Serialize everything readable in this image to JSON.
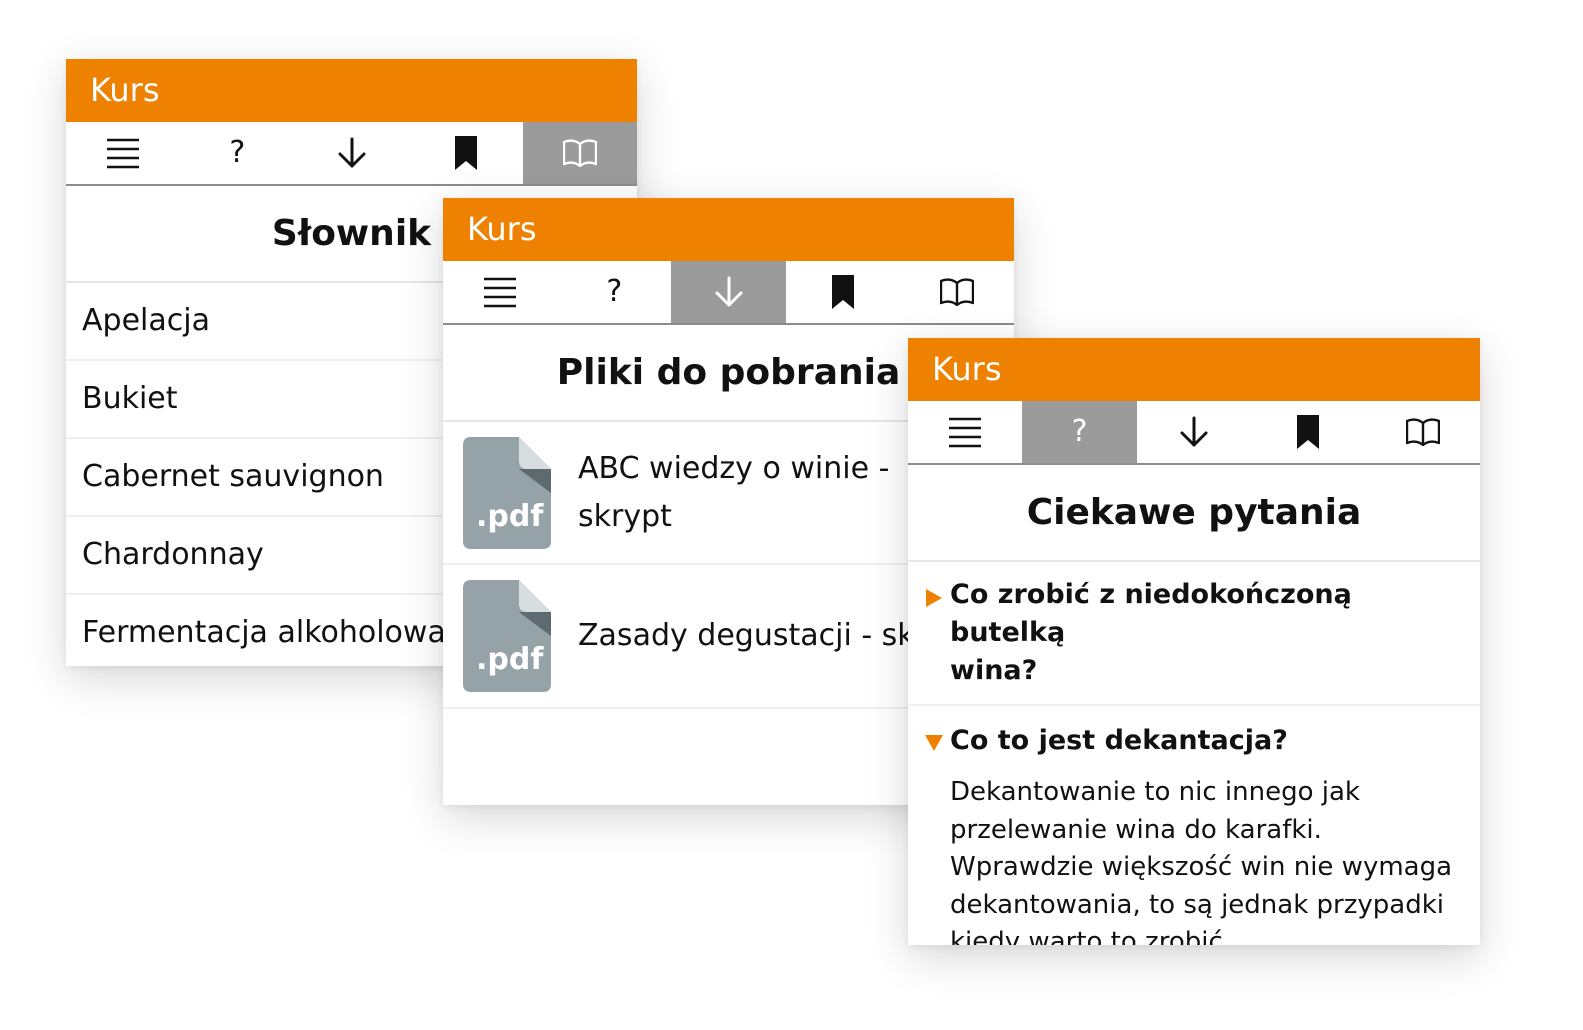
{
  "accent_color": "#ef8100",
  "active_tab_color": "#9b9b9b",
  "panels": {
    "glossary": {
      "header_title": "Kurs",
      "active_tab": "book",
      "heading": "Słownik",
      "items": [
        "Apelacja",
        "Bukiet",
        "Cabernet sauvignon",
        "Chardonnay",
        "Fermentacja alkoholowa"
      ]
    },
    "downloads": {
      "header_title": "Kurs",
      "active_tab": "download",
      "heading": "Pliki do pobrania",
      "files": [
        {
          "icon_label": ".pdf",
          "title_line1": "ABC wiedzy o winie -",
          "title_line2": "skrypt"
        },
        {
          "icon_label": ".pdf",
          "title": "Zasady degustacji - skr"
        }
      ]
    },
    "faq": {
      "header_title": "Kurs",
      "active_tab": "help",
      "heading": "Ciekawe pytania",
      "questions": [
        {
          "question_line1": "Co zrobić z niedokończoną butelką",
          "question_line2": "wina?",
          "expanded": false
        },
        {
          "question": "Co to jest dekantacja?",
          "expanded": true,
          "answer_lines": [
            "Dekantowanie to nic innego jak",
            "przelewanie wina do karafki.",
            "Wprawdzie większość win nie wymaga",
            "dekantowania, to są jednak przypadki",
            "kiedy warto to zrobić."
          ]
        }
      ]
    }
  },
  "toolbar": {
    "icons": [
      "menu-icon",
      "help-icon",
      "download-icon",
      "bookmark-icon",
      "book-icon"
    ],
    "help_label": "?"
  }
}
